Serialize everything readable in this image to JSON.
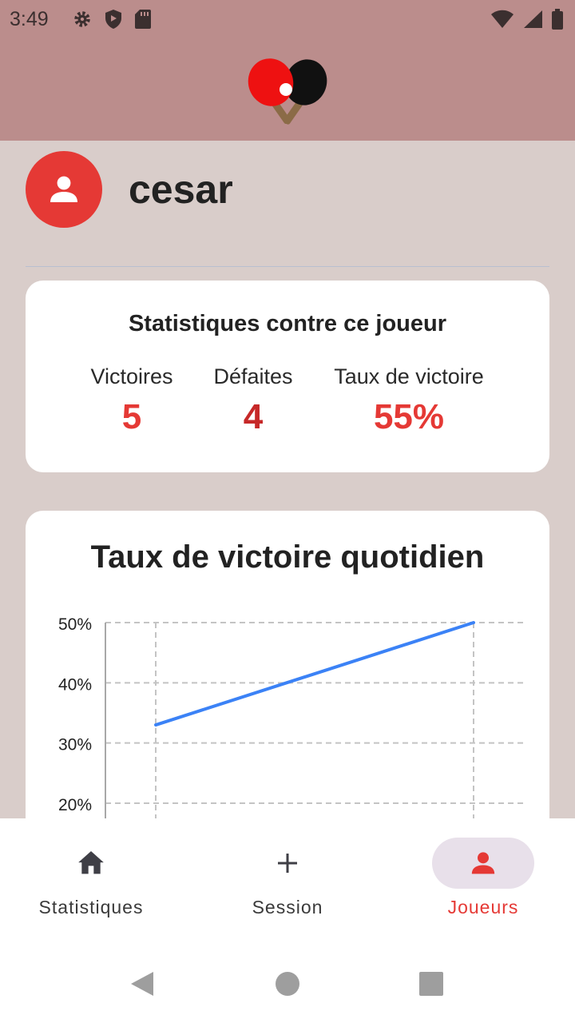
{
  "status_bar": {
    "time": "3:49"
  },
  "player": {
    "name": "cesar"
  },
  "stats": {
    "title": "Statistiques contre ce joueur",
    "victories": {
      "label": "Victoires",
      "value": "5"
    },
    "defeats": {
      "label": "Défaites",
      "value": "4"
    },
    "win_rate": {
      "label": "Taux de victoire",
      "value": "55%"
    }
  },
  "chart": {
    "title": "Taux de victoire quotidien"
  },
  "chart_data": {
    "type": "line",
    "title": "Taux de victoire quotidien",
    "y_ticks": [
      "50%",
      "40%",
      "30%",
      "20%"
    ],
    "ylim": [
      20,
      50
    ],
    "series": [
      {
        "values": [
          33,
          50
        ]
      }
    ],
    "grid": true
  },
  "nav": {
    "items": [
      {
        "label": "Statistiques",
        "icon": "home-icon"
      },
      {
        "label": "Session",
        "icon": "plus-icon"
      },
      {
        "label": "Joueurs",
        "icon": "person-icon",
        "active": true
      }
    ]
  },
  "colors": {
    "accent": "#e53935",
    "defeat": "#c62828",
    "line": "#3b82f6",
    "header": "#bb8d8c",
    "background": "#d9cdca"
  }
}
